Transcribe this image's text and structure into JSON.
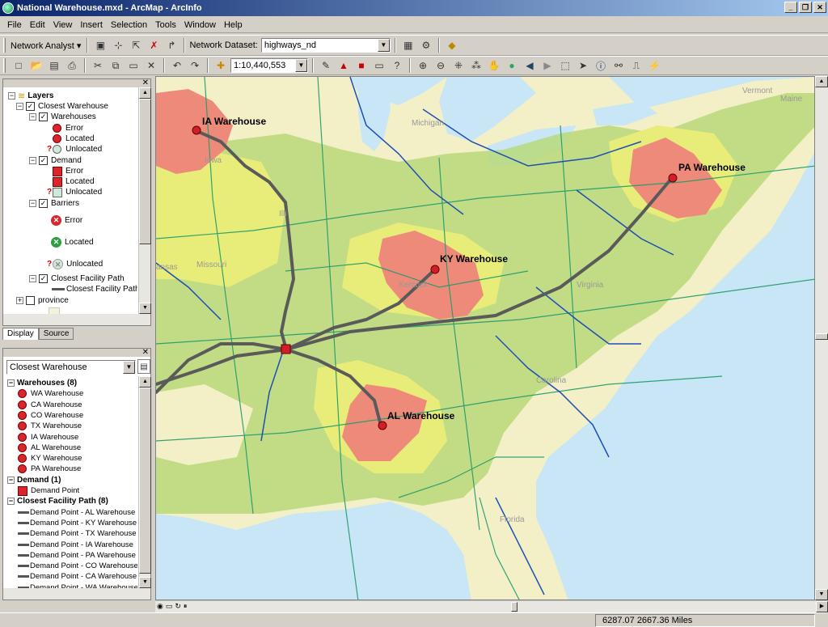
{
  "window": {
    "title": "National Warehouse.mxd - ArcMap - ArcInfo"
  },
  "menu": [
    "File",
    "Edit",
    "View",
    "Insert",
    "Selection",
    "Tools",
    "Window",
    "Help"
  ],
  "network_toolbar": {
    "analyst_label": "Network Analyst ▾",
    "dataset_label": "Network Dataset:",
    "dataset_value": "highways_nd"
  },
  "standard_toolbar": {
    "scale_value": "1:10,440,553"
  },
  "toc": {
    "layers_label": "Layers",
    "closest_warehouse": "Closest Warehouse",
    "warehouses": "Warehouses",
    "w_error": "Error",
    "w_located": "Located",
    "w_unlocated": "Unlocated",
    "demand": "Demand",
    "d_error": "Error",
    "d_located": "Located",
    "d_unlocated": "Unlocated",
    "barriers": "Barriers",
    "b_error": "Error",
    "b_located": "Located",
    "b_unlocated": "Unlocated",
    "cfp": "Closest Facility Path",
    "cfp_sym": "Closest Facility Path",
    "province": "province",
    "tabs": [
      "Display",
      "Source"
    ]
  },
  "results": {
    "dropdown_value": "Closest Warehouse",
    "warehouses_header": "Warehouses (8)",
    "warehouses": [
      "WA Warehouse",
      "CA Warehouse",
      "CO Warehouse",
      "TX Warehouse",
      "IA Warehouse",
      "AL Warehouse",
      "KY Warehouse",
      "PA Warehouse"
    ],
    "demand_header": "Demand (1)",
    "demand": [
      "Demand Point"
    ],
    "paths_header": "Closest Facility Path (8)",
    "paths": [
      "Demand Point - AL Warehouse",
      "Demand Point - KY Warehouse",
      "Demand Point - TX Warehouse",
      "Demand Point - IA Warehouse",
      "Demand Point - PA Warehouse",
      "Demand Point - CO Warehouse",
      "Demand Point - CA Warehouse",
      "Demand Point - WA Warehouse"
    ]
  },
  "map": {
    "labels": {
      "ia": "IA Warehouse",
      "pa": "PA Warehouse",
      "ky": "KY Warehouse",
      "al": "AL Warehouse",
      "missouri": "Missouri",
      "iowa": "Iowa",
      "illinois": "Illi",
      "michigan": "Michigan",
      "virginia": "Virginia",
      "carolina": "Carolina",
      "kentucky": "Kentuck",
      "kansas": "ansas",
      "florida": "Florida",
      "maine": "Maine",
      "vermont": "Vermont"
    },
    "colors": {
      "water": "#c8e6f5",
      "land_base": "#f3f0c8",
      "zone_green": "#b9d87a",
      "zone_yellow": "#e8ec78",
      "zone_red": "#ee8a7a",
      "route": "#5a5a5a",
      "highway": "#1e4fb4",
      "roads_green": "#1f9a6a",
      "facility": "#d21e28"
    }
  },
  "status": {
    "coords": "6287.07  2667.36 Miles"
  }
}
